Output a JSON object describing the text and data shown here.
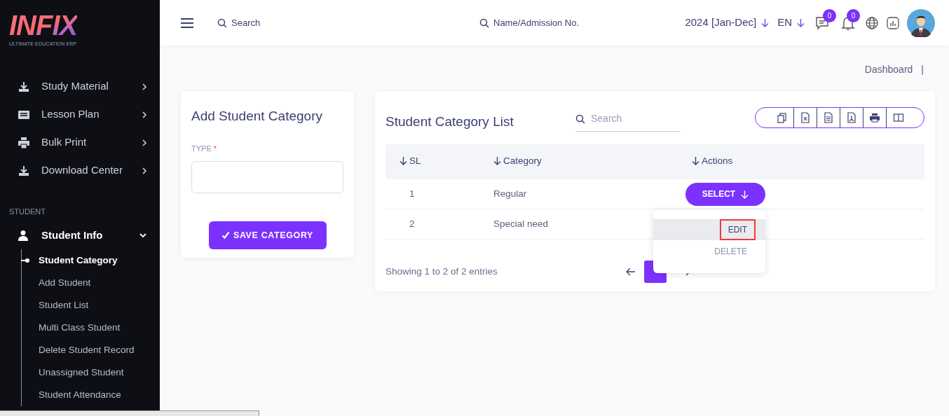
{
  "logo": {
    "text": "INFIX",
    "tagline": "ULTIMATE EDUCATION ERP"
  },
  "sidebar": {
    "items": [
      {
        "label": "Study Material",
        "kind": "download",
        "expanded": false
      },
      {
        "label": "Lesson Plan",
        "kind": "board",
        "expanded": false
      },
      {
        "label": "Bulk Print",
        "kind": "printer",
        "expanded": false
      },
      {
        "label": "Download Center",
        "kind": "download",
        "expanded": false
      }
    ],
    "section": "STUDENT",
    "group": {
      "label": "Student Info",
      "expanded": true,
      "children": [
        {
          "label": "Student Category",
          "selected": true
        },
        {
          "label": "Add Student",
          "selected": false
        },
        {
          "label": "Student List",
          "selected": false
        },
        {
          "label": "Multi Class Student",
          "selected": false
        },
        {
          "label": "Delete Student Record",
          "selected": false
        },
        {
          "label": "Unassigned Student",
          "selected": false
        },
        {
          "label": "Student Attendance",
          "selected": false
        }
      ]
    }
  },
  "header": {
    "search": {
      "placeholder": "Search"
    },
    "admission_search": "Name/Admission No.",
    "session": "2024 [Jan-Dec]",
    "language": "EN",
    "messages_badge": "0",
    "notifications_badge": "0"
  },
  "breadcrumb": {
    "items": [
      "Dashboard",
      "|"
    ]
  },
  "form": {
    "title": "Add Student Category",
    "field_label": "TYPE",
    "required_mark": "*",
    "button": "SAVE CATEGORY"
  },
  "list": {
    "title": "Student Category List",
    "search": {
      "placeholder": "Search"
    },
    "columns": [
      "SL",
      "Category",
      "Actions"
    ],
    "rows": [
      {
        "sl": "1",
        "category": "Regular",
        "action": "SELECT"
      },
      {
        "sl": "2",
        "category": "Special need"
      }
    ],
    "menu": [
      {
        "label": "EDIT",
        "selected": true
      },
      {
        "label": "DELETE",
        "selected": false
      }
    ],
    "info": "Showing 1 to 2 of 2 entries"
  }
}
